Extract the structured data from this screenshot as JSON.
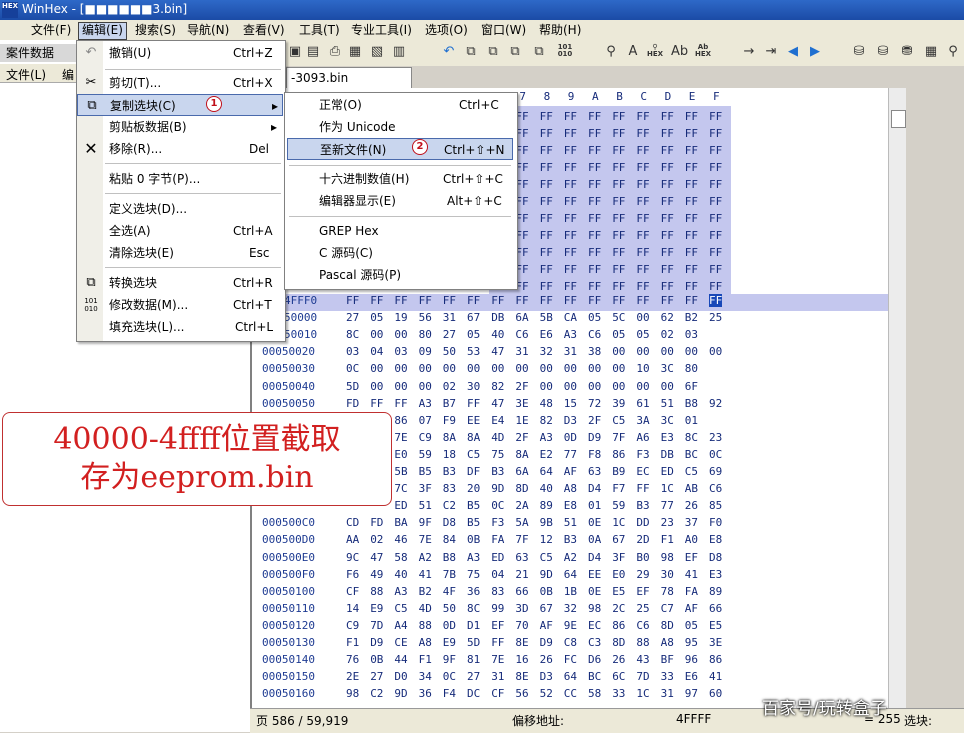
{
  "window": {
    "title": "WinHex - [■■■■■■3.bin]",
    "icon_label": "HEX"
  },
  "menubar": [
    {
      "label": "文件(F)"
    },
    {
      "label": "编辑(E)"
    },
    {
      "label": "搜索(S)"
    },
    {
      "label": "导航(N)"
    },
    {
      "label": "查看(V)"
    },
    {
      "label": "工具(T)"
    },
    {
      "label": "专业工具(I)"
    },
    {
      "label": "选项(O)"
    },
    {
      "label": "窗口(W)"
    },
    {
      "label": "帮助(H)"
    }
  ],
  "left_panel": {
    "header": "案件数据",
    "sub_items": [
      "文件(L)",
      "编"
    ]
  },
  "tab": {
    "label": "-3093.bin"
  },
  "edit_menu": {
    "items": [
      {
        "label": "撤销(U)",
        "shortcut": "Ctrl+Z",
        "icon": "undo-icon"
      },
      {
        "label": "剪切(T)...",
        "shortcut": "Ctrl+X",
        "icon": "scissors-icon"
      },
      {
        "label": "复制选块(C)",
        "shortcut": "",
        "icon": "copy-icon"
      },
      {
        "label": "剪贴板数据(B)",
        "shortcut": "",
        "icon": ""
      },
      {
        "label": "移除(R)...",
        "shortcut": "Del",
        "icon": "delete-x-icon"
      },
      {
        "label": "粘贴 0 字节(P)...",
        "shortcut": "",
        "icon": ""
      },
      {
        "label": "定义选块(D)...",
        "shortcut": "",
        "icon": ""
      },
      {
        "label": "全选(A)",
        "shortcut": "Ctrl+A",
        "icon": ""
      },
      {
        "label": "清除选块(E)",
        "shortcut": "Esc",
        "icon": ""
      },
      {
        "label": "转换选块",
        "shortcut": "Ctrl+R",
        "icon": "convert-icon"
      },
      {
        "label": "修改数据(M)...",
        "shortcut": "Ctrl+T",
        "icon": "binary-icon"
      },
      {
        "label": "填充选块(L)...",
        "shortcut": "Ctrl+L",
        "icon": ""
      }
    ]
  },
  "copy_menu": {
    "items": [
      {
        "label": "正常(O)",
        "shortcut": "Ctrl+C"
      },
      {
        "label": "作为 Unicode",
        "shortcut": ""
      },
      {
        "label": "至新文件(N)",
        "shortcut": "Ctrl+⇧+N"
      },
      {
        "label": "十六进制数值(H)",
        "shortcut": "Ctrl+⇧+C"
      },
      {
        "label": "编辑器显示(E)",
        "shortcut": "Alt+⇧+C"
      },
      {
        "label": "GREP Hex",
        "shortcut": ""
      },
      {
        "label": "C 源码(C)",
        "shortcut": ""
      },
      {
        "label": "Pascal 源码(P)",
        "shortcut": ""
      }
    ]
  },
  "badges": [
    "1",
    "2"
  ],
  "hex": {
    "col_headers": [
      "7",
      "8",
      "9",
      "A",
      "B",
      "C",
      "D",
      "E",
      "F"
    ],
    "sel_rows": [
      [
        "FF",
        "FF",
        "FF",
        "FF",
        "FF",
        "FF",
        "FF",
        "FF",
        "FF",
        "FF"
      ],
      [
        "FF",
        "FF",
        "FF",
        "FF",
        "FF",
        "FF",
        "FF",
        "FF",
        "FF",
        "FF"
      ],
      [
        "FF",
        "FF",
        "FF",
        "FF",
        "FF",
        "FF",
        "FF",
        "FF",
        "FF",
        "FF"
      ],
      [
        "FF",
        "FF",
        "FF",
        "FF",
        "FF",
        "FF",
        "FF",
        "FF",
        "FF",
        "FF"
      ],
      [
        "FF",
        "FF",
        "FF",
        "FF",
        "FF",
        "FF",
        "FF",
        "FF",
        "FF",
        "FF"
      ],
      [
        "FF",
        "FF",
        "FF",
        "FF",
        "FF",
        "FF",
        "FF",
        "FF",
        "FF",
        "FF"
      ],
      [
        "FF",
        "FF",
        "FF",
        "FF",
        "FF",
        "FF",
        "FF",
        "FF",
        "FF",
        "FF"
      ],
      [
        "FF",
        "FF",
        "FF",
        "FF",
        "FF",
        "FF",
        "FF",
        "FF",
        "FF",
        "FF"
      ],
      [
        "FF",
        "FF",
        "FF",
        "FF",
        "FF",
        "FF",
        "FF",
        "FF",
        "FF",
        "FF"
      ],
      [
        "FF",
        "FF",
        "FF",
        "FF",
        "FF",
        "FF",
        "FF",
        "FF",
        "FF",
        "FF"
      ],
      [
        "FF",
        "FF",
        "FF",
        "FF",
        "FF",
        "FF",
        "FF",
        "FF",
        "FF",
        "FF"
      ]
    ],
    "rows": [
      {
        "offset": "4FFF0",
        "bytes": [
          "FF",
          "FF",
          "FF",
          "FF",
          "FF",
          "FF",
          "FF",
          "FF",
          "FF",
          "FF",
          "FF",
          "FF",
          "FF",
          "FF",
          "FF",
          "FF"
        ]
      },
      {
        "offset": "50000",
        "bytes": [
          "27",
          "05",
          "19",
          "56",
          "31",
          "67",
          "DB",
          "6A",
          "5B",
          "CA",
          "05",
          "5C",
          "00",
          "62",
          "B2",
          "25"
        ]
      },
      {
        "offset": "50010",
        "bytes": [
          "8C",
          "00",
          "00",
          "80",
          "27",
          "05",
          "40",
          "C6",
          "E6",
          "A3",
          "C6",
          "05",
          "05",
          "02",
          "03",
          ""
        ]
      },
      {
        "offset": "00050020",
        "bytes": [
          "03",
          "04",
          "03",
          "09",
          "50",
          "53",
          "47",
          "31",
          "32",
          "31",
          "38",
          "00",
          "00",
          "00",
          "00",
          "00"
        ]
      },
      {
        "offset": "00050030",
        "bytes": [
          "0C",
          "00",
          "00",
          "00",
          "00",
          "00",
          "00",
          "00",
          "00",
          "00",
          "00",
          "00",
          "10",
          "3C",
          "80",
          ""
        ]
      },
      {
        "offset": "00050040",
        "bytes": [
          "5D",
          "00",
          "00",
          "00",
          "02",
          "30",
          "82",
          "2F",
          "00",
          "00",
          "00",
          "00",
          "00",
          "00",
          "6F",
          ""
        ]
      },
      {
        "offset": "00050050",
        "bytes": [
          "FD",
          "FF",
          "FF",
          "A3",
          "B7",
          "FF",
          "47",
          "3E",
          "48",
          "15",
          "72",
          "39",
          "61",
          "51",
          "B8",
          "92"
        ]
      },
      {
        "offset": "",
        "bytes": [
          "",
          "",
          "86",
          "07",
          "F9",
          "EE",
          "E4",
          "1E",
          "82",
          "D3",
          "2F",
          "C5",
          "3A",
          "3C",
          "01",
          ""
        ]
      },
      {
        "offset": "",
        "bytes": [
          "",
          "",
          "7E",
          "C9",
          "8A",
          "8A",
          "4D",
          "2F",
          "A3",
          "0D",
          "D9",
          "7F",
          "A6",
          "E3",
          "8C",
          "23"
        ]
      },
      {
        "offset": "",
        "bytes": [
          "",
          "",
          "E0",
          "59",
          "18",
          "C5",
          "75",
          "8A",
          "E2",
          "77",
          "F8",
          "86",
          "F3",
          "DB",
          "BC",
          "0C"
        ]
      },
      {
        "offset": "",
        "bytes": [
          "",
          "",
          "5B",
          "B5",
          "B3",
          "DF",
          "B3",
          "6A",
          "64",
          "AF",
          "63",
          "B9",
          "EC",
          "ED",
          "C5",
          "69"
        ]
      },
      {
        "offset": "",
        "bytes": [
          "",
          "",
          "7C",
          "3F",
          "83",
          "20",
          "9D",
          "8D",
          "40",
          "A8",
          "D4",
          "F7",
          "FF",
          "1C",
          "AB",
          "C6"
        ]
      },
      {
        "offset": "",
        "bytes": [
          "",
          "",
          "ED",
          "51",
          "C2",
          "B5",
          "0C",
          "2A",
          "89",
          "E8",
          "01",
          "59",
          "B3",
          "77",
          "26",
          "85"
        ]
      },
      {
        "offset": "000500C0",
        "bytes": [
          "CD",
          "FD",
          "BA",
          "9F",
          "D8",
          "B5",
          "F3",
          "5A",
          "9B",
          "51",
          "0E",
          "1C",
          "DD",
          "23",
          "37",
          "F0"
        ]
      },
      {
        "offset": "000500D0",
        "bytes": [
          "AA",
          "02",
          "46",
          "7E",
          "84",
          "0B",
          "FA",
          "7F",
          "12",
          "B3",
          "0A",
          "67",
          "2D",
          "F1",
          "A0",
          "E8"
        ]
      },
      {
        "offset": "000500E0",
        "bytes": [
          "9C",
          "47",
          "58",
          "A2",
          "B8",
          "A3",
          "ED",
          "63",
          "C5",
          "A2",
          "D4",
          "3F",
          "B0",
          "98",
          "EF",
          "D8"
        ]
      },
      {
        "offset": "000500F0",
        "bytes": [
          "F6",
          "49",
          "40",
          "41",
          "7B",
          "75",
          "04",
          "21",
          "9D",
          "64",
          "EE",
          "E0",
          "29",
          "30",
          "41",
          "E3"
        ]
      },
      {
        "offset": "00050100",
        "bytes": [
          "CF",
          "88",
          "A3",
          "B2",
          "4F",
          "36",
          "83",
          "66",
          "0B",
          "1B",
          "0E",
          "E5",
          "EF",
          "78",
          "FA",
          "89"
        ]
      },
      {
        "offset": "00050110",
        "bytes": [
          "14",
          "E9",
          "C5",
          "4D",
          "50",
          "8C",
          "99",
          "3D",
          "67",
          "32",
          "98",
          "2C",
          "25",
          "C7",
          "AF",
          "66"
        ]
      },
      {
        "offset": "00050120",
        "bytes": [
          "C9",
          "7D",
          "A4",
          "88",
          "0D",
          "D1",
          "EF",
          "70",
          "AF",
          "9E",
          "EC",
          "86",
          "C6",
          "8D",
          "05",
          "E5"
        ]
      },
      {
        "offset": "00050130",
        "bytes": [
          "F1",
          "D9",
          "CE",
          "A8",
          "E9",
          "5D",
          "FF",
          "8E",
          "D9",
          "C8",
          "C3",
          "8D",
          "88",
          "A8",
          "95",
          "3E"
        ]
      },
      {
        "offset": "00050140",
        "bytes": [
          "76",
          "0B",
          "44",
          "F1",
          "9F",
          "81",
          "7E",
          "16",
          "26",
          "FC",
          "D6",
          "26",
          "43",
          "BF",
          "96",
          "86"
        ]
      },
      {
        "offset": "00050150",
        "bytes": [
          "2E",
          "27",
          "D0",
          "34",
          "0C",
          "27",
          "31",
          "8E",
          "D3",
          "64",
          "BC",
          "6C",
          "7D",
          "33",
          "E6",
          "41"
        ]
      },
      {
        "offset": "00050160",
        "bytes": [
          "98",
          "C2",
          "9D",
          "36",
          "F4",
          "DC",
          "CF",
          "56",
          "52",
          "CC",
          "58",
          "33",
          "1C",
          "31",
          "97",
          "60"
        ]
      }
    ]
  },
  "status": {
    "page": "页 586 / 59,919",
    "offset_label": "偏移地址:",
    "offset_value": "4FFFF",
    "value": "= 255",
    "select": "选块:"
  },
  "annotation": {
    "line1": "40000-4ffff位置截取",
    "line2": "存为eeprom.bin"
  },
  "watermark": "百家号/玩转盒子"
}
